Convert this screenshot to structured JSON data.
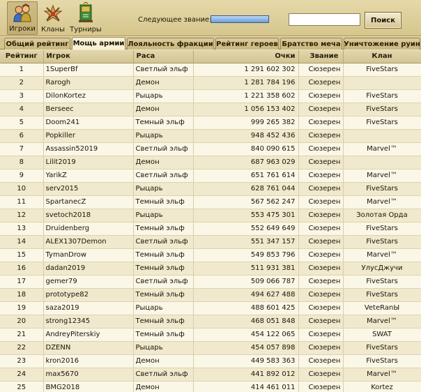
{
  "nav": {
    "players": "Игроки",
    "clans": "Кланы",
    "tournaments": "Турниры"
  },
  "next_rank": {
    "label": "Следующее звание:"
  },
  "search": {
    "value": "",
    "button": "Поиск"
  },
  "tabs": [
    {
      "label": "Общий рейтинг",
      "active": false
    },
    {
      "label": "Мощь армии",
      "active": true
    },
    {
      "label": "Лояльность фракции",
      "active": false
    },
    {
      "label": "Рейтинг героев",
      "active": false
    },
    {
      "label": "Братство меча",
      "active": false
    },
    {
      "label": "Уничтожение руин",
      "active": false
    }
  ],
  "table": {
    "headers": {
      "rank": "Рейтинг",
      "player": "Игрок",
      "race": "Раса",
      "points": "Очки",
      "title": "Звание",
      "clan": "Клан"
    },
    "rows": [
      {
        "rank": "1",
        "player": "1SuperBf",
        "race": "Светлый эльф",
        "points": "1 291 602 302",
        "title": "Сюзерен",
        "clan": "FiveStars"
      },
      {
        "rank": "2",
        "player": "Rarogh",
        "race": "Демон",
        "points": "1 281 784 196",
        "title": "Сюзерен",
        "clan": ""
      },
      {
        "rank": "3",
        "player": "DilonKortez",
        "race": "Рыцарь",
        "points": "1 221 358 602",
        "title": "Сюзерен",
        "clan": "FiveStars"
      },
      {
        "rank": "4",
        "player": "Berseec",
        "race": "Демон",
        "points": "1 056 153 402",
        "title": "Сюзерен",
        "clan": "FiveStars"
      },
      {
        "rank": "5",
        "player": "Doom241",
        "race": "Темный эльф",
        "points": "999 265 382",
        "title": "Сюзерен",
        "clan": "FiveStars"
      },
      {
        "rank": "6",
        "player": "Popkiller",
        "race": "Рыцарь",
        "points": "948 452 436",
        "title": "Сюзерен",
        "clan": ""
      },
      {
        "rank": "7",
        "player": "Assassin52019",
        "race": "Светлый эльф",
        "points": "840 090 615",
        "title": "Сюзерен",
        "clan": "Marvel™"
      },
      {
        "rank": "8",
        "player": "Lilit2019",
        "race": "Демон",
        "points": "687 963 029",
        "title": "Сюзерен",
        "clan": ""
      },
      {
        "rank": "9",
        "player": "YarikZ",
        "race": "Светлый эльф",
        "points": "651 761 614",
        "title": "Сюзерен",
        "clan": "Marvel™"
      },
      {
        "rank": "10",
        "player": "serv2015",
        "race": "Рыцарь",
        "points": "628 761 044",
        "title": "Сюзерен",
        "clan": "FiveStars"
      },
      {
        "rank": "11",
        "player": "SpartanecZ",
        "race": "Темный эльф",
        "points": "567 562 247",
        "title": "Сюзерен",
        "clan": "Marvel™"
      },
      {
        "rank": "12",
        "player": "svetoch2018",
        "race": "Рыцарь",
        "points": "553 475 301",
        "title": "Сюзерен",
        "clan": "Золотая Орда"
      },
      {
        "rank": "13",
        "player": "Druidenberg",
        "race": "Темный эльф",
        "points": "552 649 649",
        "title": "Сюзерен",
        "clan": "FiveStars"
      },
      {
        "rank": "14",
        "player": "ALEX1307Demon",
        "race": "Светлый эльф",
        "points": "551 347 157",
        "title": "Сюзерен",
        "clan": "FiveStars"
      },
      {
        "rank": "15",
        "player": "TymanDrow",
        "race": "Темный эльф",
        "points": "549 853 796",
        "title": "Сюзерен",
        "clan": "Marvel™"
      },
      {
        "rank": "16",
        "player": "dadan2019",
        "race": "Темный эльф",
        "points": "511 931 381",
        "title": "Сюзерен",
        "clan": "УлусДжучи"
      },
      {
        "rank": "17",
        "player": "gemer79",
        "race": "Светлый эльф",
        "points": "509 066 787",
        "title": "Сюзерен",
        "clan": "FiveStars"
      },
      {
        "rank": "18",
        "player": "prototype82",
        "race": "Темный эльф",
        "points": "494 627 488",
        "title": "Сюзерен",
        "clan": "FiveStars"
      },
      {
        "rank": "19",
        "player": "saza2019",
        "race": "Рыцарь",
        "points": "488 601 425",
        "title": "Сюзерен",
        "clan": "VeteRanЫ"
      },
      {
        "rank": "20",
        "player": "strong12345",
        "race": "Темный эльф",
        "points": "468 051 848",
        "title": "Сюзерен",
        "clan": "Marvel™"
      },
      {
        "rank": "21",
        "player": "AndreyPiterskiy",
        "race": "Темный эльф",
        "points": "454 122 065",
        "title": "Сюзерен",
        "clan": "SWAT"
      },
      {
        "rank": "22",
        "player": "DZENN",
        "race": "Рыцарь",
        "points": "454 057 898",
        "title": "Сюзерен",
        "clan": "FiveStars"
      },
      {
        "rank": "23",
        "player": "kron2016",
        "race": "Демон",
        "points": "449 583 363",
        "title": "Сюзерен",
        "clan": "FiveStars"
      },
      {
        "rank": "24",
        "player": "max5670",
        "race": "Светлый эльф",
        "points": "441 892 012",
        "title": "Сюзерен",
        "clan": "Marvel™"
      },
      {
        "rank": "25",
        "player": "BMG2018",
        "race": "Демон",
        "points": "414 461 011",
        "title": "Сюзерен",
        "clan": "Kortez"
      }
    ]
  }
}
